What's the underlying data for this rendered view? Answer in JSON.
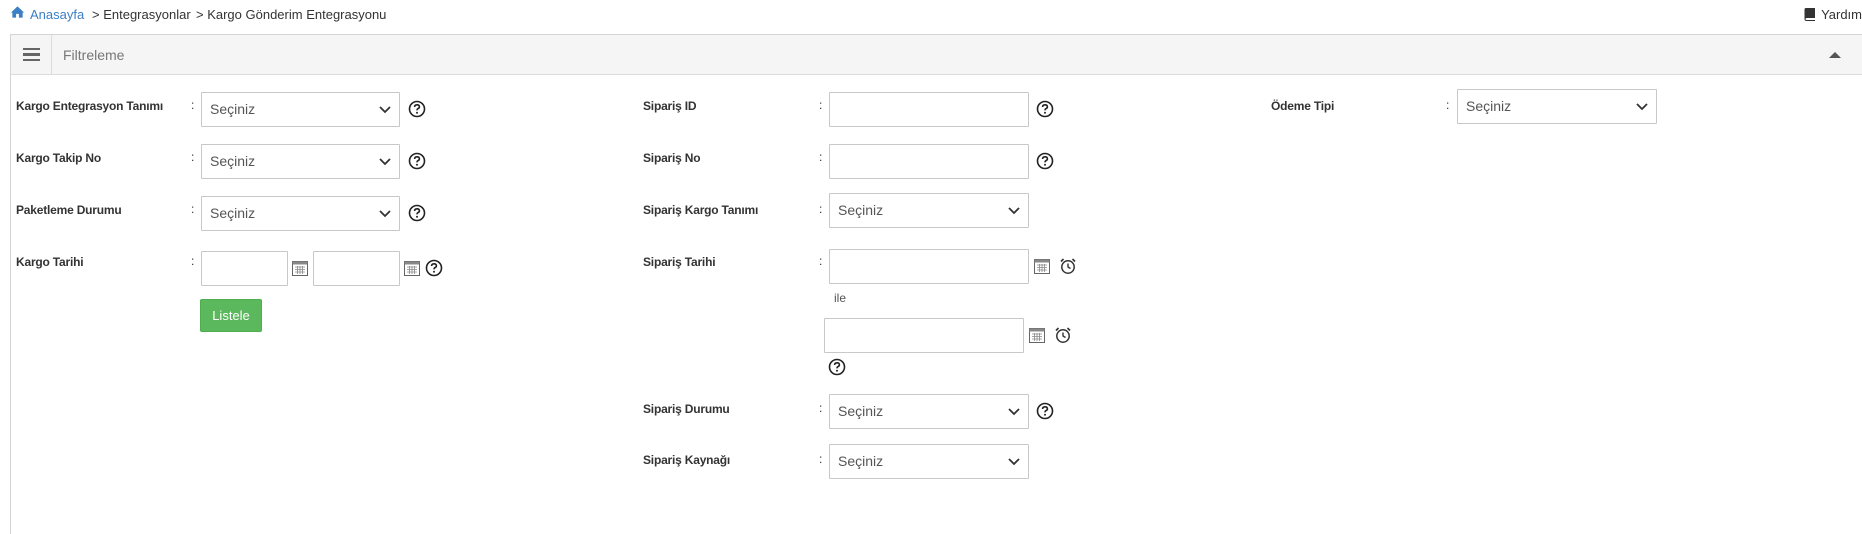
{
  "breadcrumb": {
    "home": "Anasayfa",
    "item2": "> Entegrasyonlar",
    "item3": "> Kargo Gönderim Entegrasyonu"
  },
  "help": {
    "label": "Yardım"
  },
  "panel": {
    "title": "Filtreleme"
  },
  "filters": {
    "kargo_entegrasyon_tanimi": {
      "label": "Kargo Entegrasyon Tanımı",
      "value": "Seçiniz"
    },
    "kargo_takip_no": {
      "label": "Kargo Takip No",
      "value": "Seçiniz"
    },
    "paketleme_durumu": {
      "label": "Paketleme Durumu",
      "value": "Seçiniz"
    },
    "kargo_tarihi": {
      "label": "Kargo Tarihi",
      "start": "",
      "end": ""
    },
    "siparis_id": {
      "label": "Sipariş ID",
      "value": ""
    },
    "siparis_no": {
      "label": "Sipariş No",
      "value": ""
    },
    "siparis_kargo_tanimi": {
      "label": "Sipariş Kargo Tanımı",
      "value": "Seçiniz"
    },
    "siparis_tarihi": {
      "label": "Sipariş Tarihi",
      "start": "",
      "end": "",
      "between_text": "ile"
    },
    "siparis_durumu": {
      "label": "Sipariş Durumu",
      "value": "Seçiniz"
    },
    "siparis_kaynagi": {
      "label": "Sipariş Kaynağı",
      "value": "Seçiniz"
    },
    "odeme_tipi": {
      "label": "Ödeme Tipi",
      "value": "Seçiniz"
    }
  },
  "colon": ":",
  "actions": {
    "list_label": "Listele"
  },
  "colors": {
    "link": "#3b7fc4",
    "primary_button": "#5cb85c",
    "border": "#c8c8c8",
    "header_bg": "#f5f5f5"
  },
  "icons": [
    "home-icon",
    "book-icon",
    "menu-icon",
    "caret-up-icon",
    "chevron-down-icon",
    "question-circle-icon",
    "calendar-icon",
    "alarm-clock-icon"
  ]
}
